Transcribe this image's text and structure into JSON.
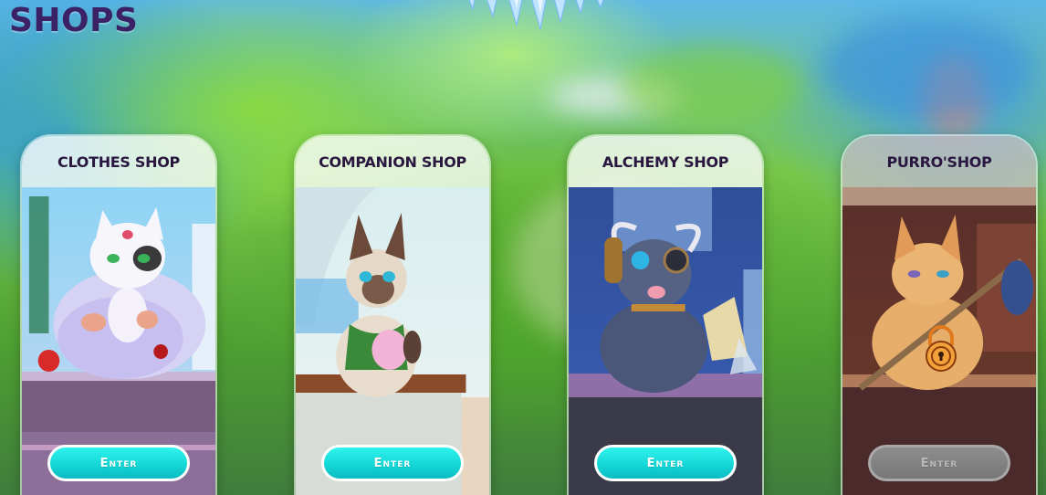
{
  "page": {
    "title": "SHOPS"
  },
  "shops": [
    {
      "title": "CLOTHES SHOP",
      "button_label": "Enter",
      "locked": false,
      "character": "white-cat-shopkeeper"
    },
    {
      "title": "COMPANION SHOP",
      "button_label": "Enter",
      "locked": false,
      "character": "siamese-cat-shopkeeper"
    },
    {
      "title": "ALCHEMY SHOP",
      "button_label": "Enter",
      "locked": false,
      "character": "grey-cat-alchemist-with-goggles"
    },
    {
      "title": "PURRO'SHOP",
      "button_label": "Enter",
      "locked": true,
      "character": "orange-cat-traveler",
      "lock_icon": "padlock-icon"
    }
  ],
  "colors": {
    "title": "#3b2165",
    "button": "#15d7d6",
    "button_locked": "#808080"
  }
}
